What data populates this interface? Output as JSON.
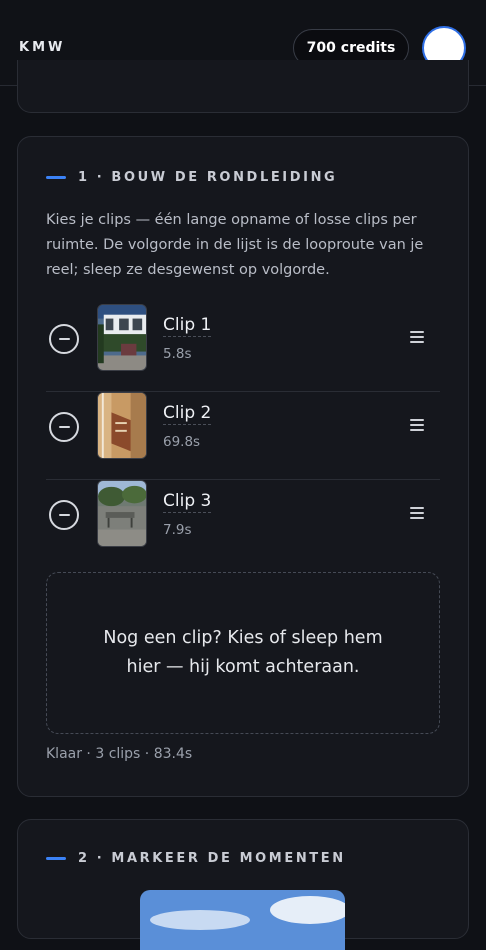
{
  "header": {
    "brand": "KMW",
    "credits_label": "700 credits"
  },
  "section1": {
    "number_title": "1 · BOUW DE RONDLEIDING",
    "intro": "Kies je clips — één lange opname of losse clips per ruimte. De volgorde in de lijst is de looproute van je reel; sleep ze desgewenst op volgorde.",
    "clips": [
      {
        "name": "Clip 1",
        "duration": "5.8s"
      },
      {
        "name": "Clip 2",
        "duration": "69.8s"
      },
      {
        "name": "Clip 3",
        "duration": "7.9s"
      }
    ],
    "dropzone_text": "Nog een clip? Kies of sleep hem hier — hij komt achteraan.",
    "summary": "Klaar · 3 clips · 83.4s"
  },
  "section2": {
    "number_title": "2 · MARKEER DE MOMENTEN"
  },
  "colors": {
    "accent": "#3b82f6",
    "background": "#0f1116",
    "card": "#15171d"
  }
}
